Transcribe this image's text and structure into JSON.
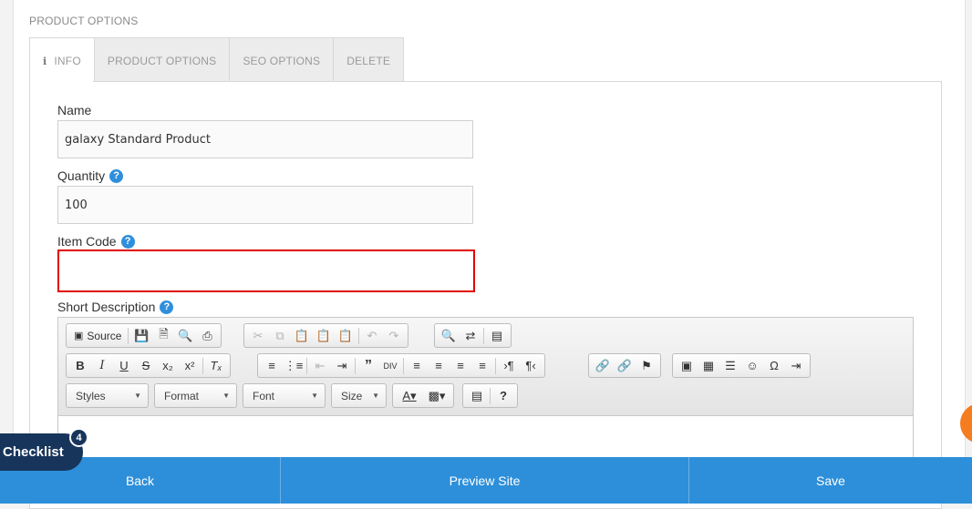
{
  "section_title": "PRODUCT OPTIONS",
  "tabs": [
    {
      "label": "INFO",
      "icon": "info-icon",
      "active": true
    },
    {
      "label": "PRODUCT OPTIONS",
      "active": false
    },
    {
      "label": "SEO OPTIONS",
      "active": false
    },
    {
      "label": "DELETE",
      "active": false
    }
  ],
  "fields": {
    "name": {
      "label": "Name",
      "value": "galaxy Standard Product"
    },
    "quantity": {
      "label": "Quantity",
      "value": "100"
    },
    "item_code": {
      "label": "Item Code",
      "value": ""
    },
    "short_description": {
      "label": "Short Description"
    }
  },
  "help_glyph": "?",
  "editor": {
    "source_label": "Source",
    "combos": {
      "styles": "Styles",
      "format": "Format",
      "font": "Font",
      "size": "Size"
    }
  },
  "checklist": {
    "label": "Checklist",
    "count": "4"
  },
  "bottom_bar": {
    "back": "Back",
    "preview": "Preview Site",
    "save": "Save"
  },
  "colors": {
    "accent": "#2d8fd9",
    "highlight": "#e00000",
    "checklist_bg": "#17355a",
    "orange": "#f57c1f"
  }
}
